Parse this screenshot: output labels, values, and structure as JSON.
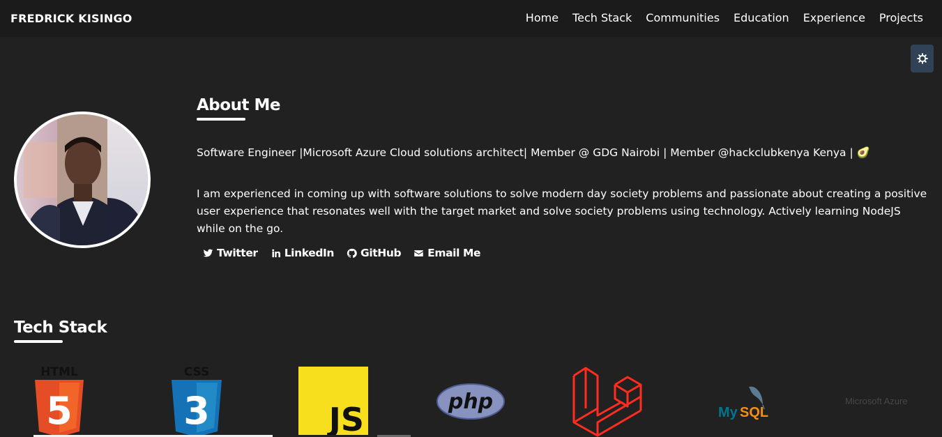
{
  "navbar": {
    "brand": "FREDRICK KISINGO",
    "links": [
      "Home",
      "Tech Stack",
      "Communities",
      "Education",
      "Experience",
      "Projects"
    ]
  },
  "theme_toggle": {
    "icon": "gear-icon"
  },
  "about": {
    "title": "About Me",
    "tagline": "Software Engineer |Microsoft Azure Cloud solutions architect| Member @ GDG Nairobi | Member @hackclubkenya Kenya | 🥑",
    "bio": "I am experienced in coming up with software solutions to solve modern day society problems and passionate about creating a positive user experience that resonates well with the target market and solve society problems using technology. Actively learning NodeJS while on the go.",
    "socials": [
      {
        "label": "Twitter",
        "icon": "twitter-icon"
      },
      {
        "label": "LinkedIn",
        "icon": "linkedin-icon"
      },
      {
        "label": "GitHub",
        "icon": "github-icon"
      },
      {
        "label": "Email Me",
        "icon": "envelope-icon"
      }
    ]
  },
  "tech_stack": {
    "title": "Tech Stack",
    "logos": {
      "html": "HTML",
      "html_num": "5",
      "css": "CSS",
      "css_num": "3",
      "js": "JS",
      "php": "php",
      "mysql_my": "My",
      "mysql_sql": "SQL",
      "azure": "Microsoft Azure"
    }
  },
  "colors": {
    "background": "#212121",
    "navbar": "#1b1b1b",
    "theme_button": "#2f4256",
    "html_orange": "#e44d26",
    "css_blue": "#2965f1",
    "js_yellow": "#f7df1e",
    "php_purple": "#8892bf",
    "laravel_red": "#ff2d20",
    "mysql_blue": "#00758f",
    "mysql_orange": "#f29111"
  }
}
